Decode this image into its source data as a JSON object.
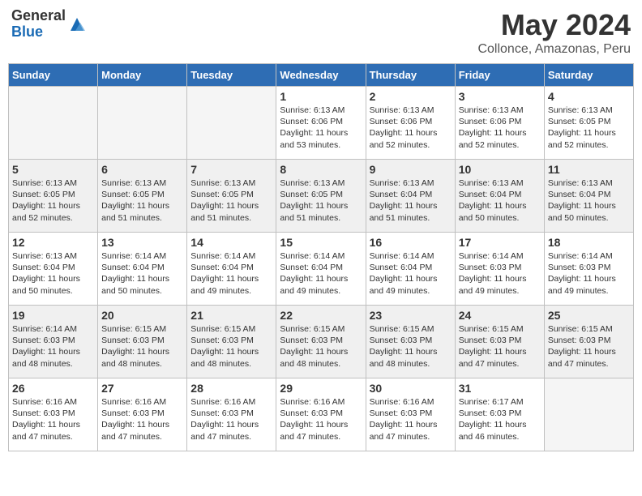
{
  "logo": {
    "general": "General",
    "blue": "Blue"
  },
  "title": {
    "month_year": "May 2024",
    "location": "Collonce, Amazonas, Peru"
  },
  "days_of_week": [
    "Sunday",
    "Monday",
    "Tuesday",
    "Wednesday",
    "Thursday",
    "Friday",
    "Saturday"
  ],
  "weeks": [
    [
      {
        "day": "",
        "info": ""
      },
      {
        "day": "",
        "info": ""
      },
      {
        "day": "",
        "info": ""
      },
      {
        "day": "1",
        "info": "Sunrise: 6:13 AM\nSunset: 6:06 PM\nDaylight: 11 hours and 53 minutes."
      },
      {
        "day": "2",
        "info": "Sunrise: 6:13 AM\nSunset: 6:06 PM\nDaylight: 11 hours and 52 minutes."
      },
      {
        "day": "3",
        "info": "Sunrise: 6:13 AM\nSunset: 6:06 PM\nDaylight: 11 hours and 52 minutes."
      },
      {
        "day": "4",
        "info": "Sunrise: 6:13 AM\nSunset: 6:05 PM\nDaylight: 11 hours and 52 minutes."
      }
    ],
    [
      {
        "day": "5",
        "info": "Sunrise: 6:13 AM\nSunset: 6:05 PM\nDaylight: 11 hours and 52 minutes."
      },
      {
        "day": "6",
        "info": "Sunrise: 6:13 AM\nSunset: 6:05 PM\nDaylight: 11 hours and 51 minutes."
      },
      {
        "day": "7",
        "info": "Sunrise: 6:13 AM\nSunset: 6:05 PM\nDaylight: 11 hours and 51 minutes."
      },
      {
        "day": "8",
        "info": "Sunrise: 6:13 AM\nSunset: 6:05 PM\nDaylight: 11 hours and 51 minutes."
      },
      {
        "day": "9",
        "info": "Sunrise: 6:13 AM\nSunset: 6:04 PM\nDaylight: 11 hours and 51 minutes."
      },
      {
        "day": "10",
        "info": "Sunrise: 6:13 AM\nSunset: 6:04 PM\nDaylight: 11 hours and 50 minutes."
      },
      {
        "day": "11",
        "info": "Sunrise: 6:13 AM\nSunset: 6:04 PM\nDaylight: 11 hours and 50 minutes."
      }
    ],
    [
      {
        "day": "12",
        "info": "Sunrise: 6:13 AM\nSunset: 6:04 PM\nDaylight: 11 hours and 50 minutes."
      },
      {
        "day": "13",
        "info": "Sunrise: 6:14 AM\nSunset: 6:04 PM\nDaylight: 11 hours and 50 minutes."
      },
      {
        "day": "14",
        "info": "Sunrise: 6:14 AM\nSunset: 6:04 PM\nDaylight: 11 hours and 49 minutes."
      },
      {
        "day": "15",
        "info": "Sunrise: 6:14 AM\nSunset: 6:04 PM\nDaylight: 11 hours and 49 minutes."
      },
      {
        "day": "16",
        "info": "Sunrise: 6:14 AM\nSunset: 6:04 PM\nDaylight: 11 hours and 49 minutes."
      },
      {
        "day": "17",
        "info": "Sunrise: 6:14 AM\nSunset: 6:03 PM\nDaylight: 11 hours and 49 minutes."
      },
      {
        "day": "18",
        "info": "Sunrise: 6:14 AM\nSunset: 6:03 PM\nDaylight: 11 hours and 49 minutes."
      }
    ],
    [
      {
        "day": "19",
        "info": "Sunrise: 6:14 AM\nSunset: 6:03 PM\nDaylight: 11 hours and 48 minutes."
      },
      {
        "day": "20",
        "info": "Sunrise: 6:15 AM\nSunset: 6:03 PM\nDaylight: 11 hours and 48 minutes."
      },
      {
        "day": "21",
        "info": "Sunrise: 6:15 AM\nSunset: 6:03 PM\nDaylight: 11 hours and 48 minutes."
      },
      {
        "day": "22",
        "info": "Sunrise: 6:15 AM\nSunset: 6:03 PM\nDaylight: 11 hours and 48 minutes."
      },
      {
        "day": "23",
        "info": "Sunrise: 6:15 AM\nSunset: 6:03 PM\nDaylight: 11 hours and 48 minutes."
      },
      {
        "day": "24",
        "info": "Sunrise: 6:15 AM\nSunset: 6:03 PM\nDaylight: 11 hours and 47 minutes."
      },
      {
        "day": "25",
        "info": "Sunrise: 6:15 AM\nSunset: 6:03 PM\nDaylight: 11 hours and 47 minutes."
      }
    ],
    [
      {
        "day": "26",
        "info": "Sunrise: 6:16 AM\nSunset: 6:03 PM\nDaylight: 11 hours and 47 minutes."
      },
      {
        "day": "27",
        "info": "Sunrise: 6:16 AM\nSunset: 6:03 PM\nDaylight: 11 hours and 47 minutes."
      },
      {
        "day": "28",
        "info": "Sunrise: 6:16 AM\nSunset: 6:03 PM\nDaylight: 11 hours and 47 minutes."
      },
      {
        "day": "29",
        "info": "Sunrise: 6:16 AM\nSunset: 6:03 PM\nDaylight: 11 hours and 47 minutes."
      },
      {
        "day": "30",
        "info": "Sunrise: 6:16 AM\nSunset: 6:03 PM\nDaylight: 11 hours and 47 minutes."
      },
      {
        "day": "31",
        "info": "Sunrise: 6:17 AM\nSunset: 6:03 PM\nDaylight: 11 hours and 46 minutes."
      },
      {
        "day": "",
        "info": ""
      }
    ]
  ]
}
